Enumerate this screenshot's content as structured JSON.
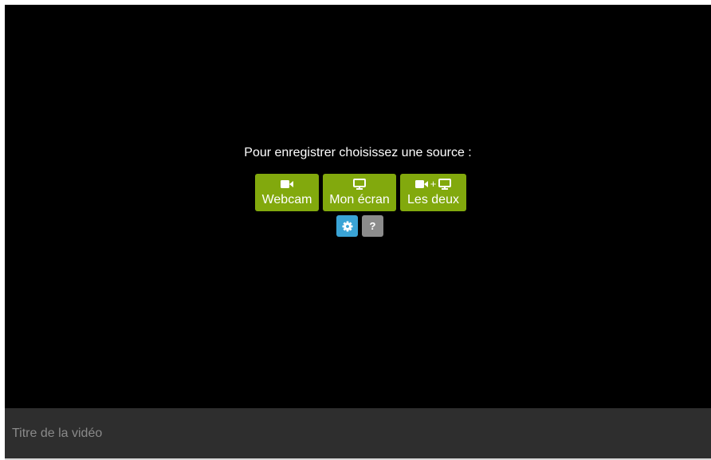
{
  "recorder": {
    "prompt": "Pour enregistrer choisissez une source :",
    "sources": [
      {
        "label": "Webcam",
        "icon": "video-camera-icon"
      },
      {
        "label": "Mon écran",
        "icon": "monitor-icon"
      },
      {
        "label": "Les deux",
        "icon": "video-camera-plus-monitor-icon",
        "separator": "+"
      }
    ],
    "settings_icon": "gear-icon",
    "help_label": "?"
  },
  "title_field": {
    "placeholder": "Titre de la vidéo",
    "value": ""
  },
  "colors": {
    "stage_background": "#000000",
    "source_button": "#82a90d",
    "settings_button": "#3aa4d6",
    "help_button": "#8c8c8c",
    "title_bar": "#2e2e2e"
  }
}
